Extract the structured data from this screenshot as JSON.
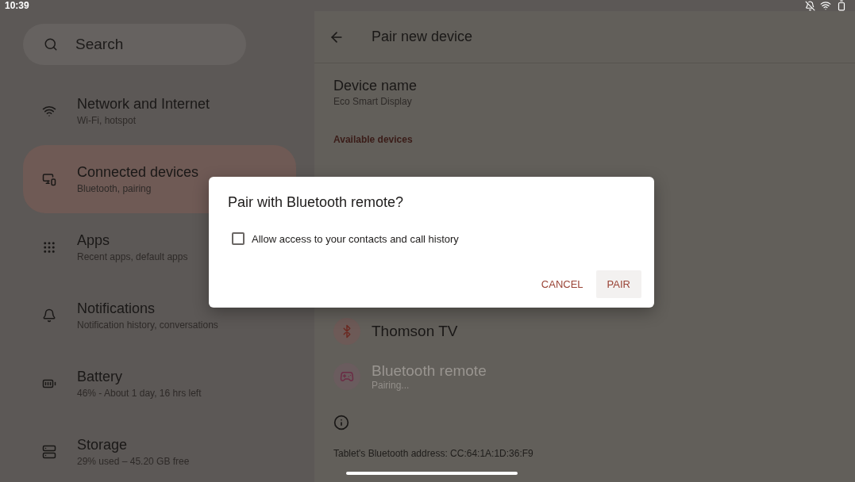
{
  "status_bar": {
    "time": "10:39"
  },
  "sidebar": {
    "search": {
      "placeholder": "Search"
    },
    "items": [
      {
        "title": "Network and Internet",
        "subtitle": "Wi-Fi, hotspot",
        "selected": false
      },
      {
        "title": "Connected devices",
        "subtitle": "Bluetooth, pairing",
        "selected": true
      },
      {
        "title": "Apps",
        "subtitle": "Recent apps, default apps",
        "selected": false
      },
      {
        "title": "Notifications",
        "subtitle": "Notification history, conversations",
        "selected": false
      },
      {
        "title": "Battery",
        "subtitle": "46% - About 1 day, 16 hrs left",
        "selected": false
      },
      {
        "title": "Storage",
        "subtitle": "29% used – 45.20 GB free",
        "selected": false
      }
    ]
  },
  "detail": {
    "title": "Pair new device",
    "device_name": {
      "label": "Device name",
      "value": "Eco Smart Display"
    },
    "section_header": "Available devices",
    "devices": [
      {
        "kind": "bluetooth",
        "name": "Thomson TV",
        "disabled": false
      },
      {
        "kind": "gamepad",
        "name": "Bluetooth remote",
        "status": "Pairing...",
        "disabled": true
      }
    ],
    "footer": "Tablet's Bluetooth address: CC:64:1A:1D:36:F9"
  },
  "dialog": {
    "title": "Pair with Bluetooth remote?",
    "checkbox": {
      "label": "Allow access to your contacts and call history",
      "checked": false
    },
    "buttons": [
      {
        "label": "CANCEL",
        "selected": false
      },
      {
        "label": "PAIR",
        "selected": true
      }
    ]
  }
}
